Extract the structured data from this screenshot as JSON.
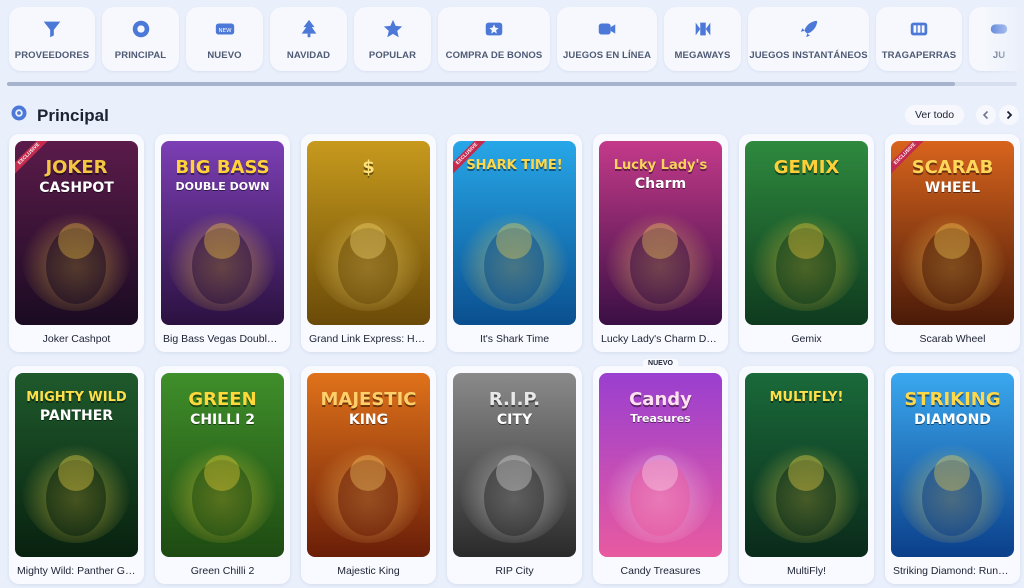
{
  "categories": [
    {
      "label": "PROVEEDORES",
      "icon": "funnel-icon",
      "width": 86
    },
    {
      "label": "PRINCIPAL",
      "icon": "gear-icon",
      "width": 77
    },
    {
      "label": "NUEVO",
      "icon": "new-tag-icon",
      "width": 77
    },
    {
      "label": "NAVIDAD",
      "icon": "christmas-tree-icon",
      "width": 77
    },
    {
      "label": "POPULAR",
      "icon": "star-icon",
      "width": 77
    },
    {
      "label": "COMPRA DE BONOS",
      "icon": "bonus-star-icon",
      "width": 112
    },
    {
      "label": "JUEGOS EN LÍNEA",
      "icon": "live-camera-icon",
      "width": 100
    },
    {
      "label": "MEGAWAYS",
      "icon": "megaways-icon",
      "width": 77
    },
    {
      "label": "JUEGOS INSTANTÁNEOS",
      "icon": "rocket-icon",
      "width": 121
    },
    {
      "label": "TRAGAPERRAS",
      "icon": "slot-machine-icon",
      "width": 86
    },
    {
      "label": "JU",
      "icon": "game-icon",
      "width": 60
    }
  ],
  "section": {
    "title": "Principal",
    "icon": "gear-icon",
    "view_all": "Ver todo"
  },
  "games": [
    {
      "name": "Joker Cashpot",
      "art": "JOKER",
      "art2": "CASHPOT",
      "ribbon": "EXCLUSIVE",
      "bg1": "#5b1b4a",
      "bg2": "#1a0b22",
      "accent": "#f4c542",
      "badge": ""
    },
    {
      "name": "Big Bass Vegas Double Down Deluxe",
      "art": "BIG BASS",
      "art2": "DOUBLE DOWN",
      "ribbon": "",
      "bg1": "#7c3fb5",
      "bg2": "#2b1140",
      "accent": "#ffd23a",
      "badge": ""
    },
    {
      "name": "Grand Link Express: Hold and Win",
      "art": "$",
      "art2": "",
      "ribbon": "",
      "bg1": "#c79a1d",
      "bg2": "#6a4a08",
      "accent": "#ffe27a",
      "badge": ""
    },
    {
      "name": "It's Shark Time",
      "art": "SHARK TIME!",
      "art2": "",
      "ribbon": "EXCLUSIVE",
      "bg1": "#27a7e8",
      "bg2": "#0a4f8f",
      "accent": "#ffd84a",
      "badge": ""
    },
    {
      "name": "Lucky Lady's Charm Deluxe",
      "art": "Lucky Lady's",
      "art2": "Charm",
      "ribbon": "",
      "bg1": "#c43a8a",
      "bg2": "#3a0f44",
      "accent": "#f9d35c",
      "badge": ""
    },
    {
      "name": "Gemix",
      "art": "GEMIX",
      "art2": "",
      "ribbon": "",
      "bg1": "#2e8a3e",
      "bg2": "#0f3a1e",
      "accent": "#ffcf3a",
      "badge": ""
    },
    {
      "name": "Scarab Wheel",
      "art": "SCARAB",
      "art2": "WHEEL",
      "ribbon": "EXCLUSIVE",
      "bg1": "#d8641d",
      "bg2": "#4a1a08",
      "accent": "#ffd55a",
      "badge": ""
    },
    {
      "name": "Mighty Wild: Panther Grand Diamond",
      "art": "MIGHTY WILD",
      "art2": "PANTHER",
      "ribbon": "",
      "bg1": "#1f5a2c",
      "bg2": "#08210f",
      "accent": "#ffe04a",
      "badge": ""
    },
    {
      "name": "Green Chilli 2",
      "art": "GREEN",
      "art2": "CHILLI 2",
      "ribbon": "",
      "bg1": "#3f8f2a",
      "bg2": "#1e4a12",
      "accent": "#ffd93a",
      "badge": ""
    },
    {
      "name": "Majestic King",
      "art": "MAJESTIC",
      "art2": "KING",
      "ribbon": "",
      "bg1": "#e0721a",
      "bg2": "#6a1e08",
      "accent": "#ffd06a",
      "badge": ""
    },
    {
      "name": "RIP City",
      "art": "R.I.P.",
      "art2": "CITY",
      "ribbon": "",
      "bg1": "#8a8a8a",
      "bg2": "#2a2a2a",
      "accent": "#e8e8e8",
      "badge": ""
    },
    {
      "name": "Candy Treasures",
      "art": "Candy",
      "art2": "Treasures",
      "ribbon": "",
      "bg1": "#9a3fd0",
      "bg2": "#e85aa0",
      "accent": "#ffe1f0",
      "badge": "NUEVO"
    },
    {
      "name": "MultiFly!",
      "art": "MULTIFLY!",
      "art2": "",
      "ribbon": "",
      "bg1": "#1a6a3a",
      "bg2": "#0a2a1a",
      "accent": "#ffe04a",
      "badge": ""
    },
    {
      "name": "Striking Diamond: Running Wins",
      "art": "STRIKING",
      "art2": "DIAMOND",
      "ribbon": "",
      "bg1": "#3aa8ef",
      "bg2": "#0b3f8a",
      "accent": "#ffd84a",
      "badge": ""
    }
  ],
  "colors": {
    "accent": "#4c78d8",
    "card_bg": "#f8faff",
    "page_bg": "#e9effb"
  }
}
